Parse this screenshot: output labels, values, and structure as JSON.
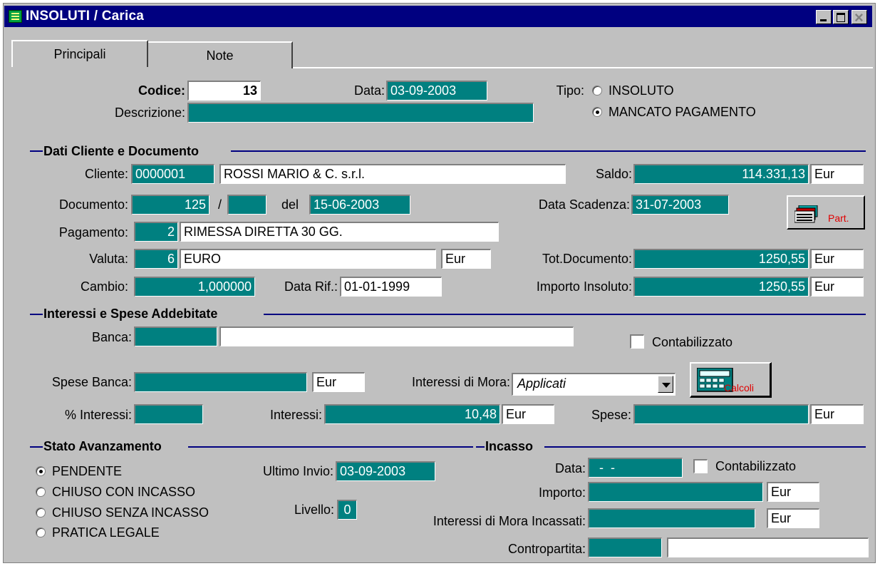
{
  "window": {
    "title": "INSOLUTI / Carica"
  },
  "tabs": [
    {
      "label": "Principali"
    },
    {
      "label": "Note"
    }
  ],
  "header": {
    "codice_label": "Codice:",
    "codice": "13",
    "data_label": "Data:",
    "data": "03-09-2003",
    "descrizione_label": "Descrizione:",
    "descrizione": "",
    "tipo_label": "Tipo:",
    "tipo_options": [
      {
        "label": "INSOLUTO",
        "selected": false
      },
      {
        "label": "MANCATO PAGAMENTO",
        "selected": true
      }
    ]
  },
  "cliente_section": {
    "title": "Dati Cliente e Documento",
    "cliente_label": "Cliente:",
    "cliente_code": "0000001",
    "cliente_name": "ROSSI MARIO & C. s.r.l.",
    "saldo_label": "Saldo:",
    "saldo": "114.331,13",
    "saldo_currency": "Eur",
    "documento_label": "Documento:",
    "documento_num": "125",
    "documento_sep": "/",
    "documento_serie": "",
    "del_label": "del",
    "documento_date": "15-06-2003",
    "scadenza_label": "Data Scadenza:",
    "scadenza": "31-07-2003",
    "part_button": "Part.",
    "pagamento_label": "Pagamento:",
    "pagamento_code": "2",
    "pagamento_desc": "RIMESSA DIRETTA 30 GG.",
    "valuta_label": "Valuta:",
    "valuta_code": "6",
    "valuta_desc": "EURO",
    "valuta_symbol": "Eur",
    "totdoc_label": "Tot.Documento:",
    "totdoc": "1250,55",
    "totdoc_currency": "Eur",
    "cambio_label": "Cambio:",
    "cambio": "1,000000",
    "datarif_label": "Data Rif.:",
    "datarif": "01-01-1999",
    "importo_ins_label": "Importo Insoluto:",
    "importo_ins": "1250,55",
    "importo_ins_currency": "Eur"
  },
  "interessi_section": {
    "title": "Interessi e Spese Addebitate",
    "banca_label": "Banca:",
    "banca_code": "",
    "banca_name": "",
    "contabilizzato_label": "Contabilizzato",
    "spese_banca_label": "Spese Banca:",
    "spese_banca": "",
    "spese_banca_currency": "Eur",
    "mora_label": "Interessi di Mora:",
    "mora_value": "Applicati",
    "calcoli_button": "Calcoli",
    "perc_label": "% Interessi:",
    "perc": "",
    "interessi_label": "Interessi:",
    "interessi": "10,48",
    "interessi_currency": "Eur",
    "spese_label": "Spese:",
    "spese": "",
    "spese_currency": "Eur"
  },
  "stato_section": {
    "title": "Stato Avanzamento",
    "options": [
      {
        "label": "PENDENTE",
        "selected": true
      },
      {
        "label": "CHIUSO CON INCASSO",
        "selected": false
      },
      {
        "label": "CHIUSO SENZA INCASSO",
        "selected": false
      },
      {
        "label": "PRATICA LEGALE",
        "selected": false
      }
    ],
    "ultimo_invio_label": "Ultimo Invio:",
    "ultimo_invio": "03-09-2003",
    "livello_label": "Livello:",
    "livello": "0"
  },
  "incasso_section": {
    "title": "Incasso",
    "data_label": "Data:",
    "data": "  -  -",
    "contabilizzato_label": "Contabilizzato",
    "importo_label": "Importo:",
    "importo": "",
    "importo_currency": "Eur",
    "mora_incassati_label": "Interessi di Mora Incassati:",
    "mora_incassati": "",
    "mora_incassati_currency": "Eur",
    "contropartita_label": "Contropartita:",
    "contropartita_code": "",
    "contropartita_desc": ""
  }
}
